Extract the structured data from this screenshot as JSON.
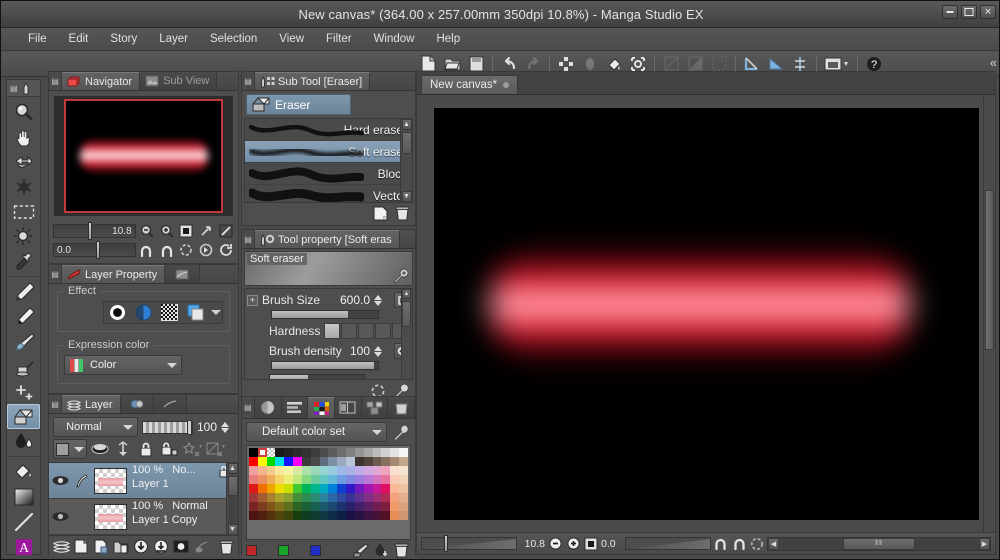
{
  "window": {
    "title": "New canvas* (364.00 x 257.00mm 350dpi 10.8%)  - Manga Studio EX",
    "minimize_label": "Minimize",
    "maximize_label": "Maximize",
    "close_label": "Close"
  },
  "menubar": {
    "items": [
      {
        "label": "File"
      },
      {
        "label": "Edit"
      },
      {
        "label": "Story"
      },
      {
        "label": "Layer"
      },
      {
        "label": "Selection"
      },
      {
        "label": "View"
      },
      {
        "label": "Filter"
      },
      {
        "label": "Window"
      },
      {
        "label": "Help"
      }
    ]
  },
  "command_toolbar": {
    "collapse_glyph": "«",
    "buttons": [
      {
        "name": "new-file-icon",
        "enabled": true
      },
      {
        "name": "open-file-icon",
        "enabled": true
      },
      {
        "name": "save-file-icon",
        "enabled": true
      },
      {
        "name": "undo-icon",
        "enabled": true
      },
      {
        "name": "redo-icon",
        "enabled": false
      },
      {
        "name": "select-all-icon",
        "enabled": true
      },
      {
        "name": "deselect-icon",
        "enabled": false
      },
      {
        "name": "fill-icon",
        "enabled": true
      },
      {
        "name": "transform-icon",
        "enabled": true
      },
      {
        "name": "clear-icon",
        "enabled": false
      },
      {
        "name": "invert-icon",
        "enabled": false
      },
      {
        "name": "selection-border-icon",
        "enabled": false
      },
      {
        "name": "ruler-line-icon",
        "enabled": true
      },
      {
        "name": "ruler-curve-icon",
        "enabled": true
      },
      {
        "name": "ruler-symmetry-icon",
        "enabled": true
      },
      {
        "name": "show-frame-icon",
        "enabled": true
      },
      {
        "name": "help-icon",
        "enabled": true
      }
    ]
  },
  "tools": {
    "groups": [
      {
        "items": [
          {
            "name": "zoom-tool",
            "label": "Zoom",
            "selected": false
          },
          {
            "name": "hand-tool",
            "label": "Hand",
            "selected": false
          },
          {
            "name": "move-tool",
            "label": "Move layer",
            "selected": false
          },
          {
            "name": "operation-tool",
            "label": "Operation",
            "selected": false
          },
          {
            "name": "rectangle-select-tool",
            "label": "Selection area",
            "selected": false
          },
          {
            "name": "auto-select-tool",
            "label": "Auto select",
            "selected": false
          },
          {
            "name": "eyedropper-tool",
            "label": "Eyedropper",
            "selected": false
          }
        ]
      },
      {
        "items": [
          {
            "name": "pencil-tool",
            "label": "Pencil",
            "selected": false
          },
          {
            "name": "pen-tool",
            "label": "Pen",
            "selected": false
          },
          {
            "name": "brush-tool",
            "label": "Brush",
            "selected": false
          },
          {
            "name": "airbrush-tool",
            "label": "Airbrush",
            "selected": false
          },
          {
            "name": "decoration-tool",
            "label": "Decoration",
            "selected": false
          },
          {
            "name": "eraser-tool",
            "label": "Eraser",
            "selected": true
          },
          {
            "name": "blend-tool",
            "label": "Blend",
            "selected": false
          }
        ]
      },
      {
        "items": [
          {
            "name": "fill-tool",
            "label": "Fill",
            "selected": false
          },
          {
            "name": "gradient-tool",
            "label": "Gradient",
            "selected": false
          },
          {
            "name": "figure-tool",
            "label": "Figure",
            "selected": false
          },
          {
            "name": "text-tool",
            "label": "Text",
            "selected": false
          }
        ]
      }
    ]
  },
  "navigator": {
    "tabs": [
      {
        "label": "Navigator",
        "icon": "navigator-icon",
        "active": true
      },
      {
        "label": "Sub View",
        "icon": "subview-icon",
        "active": false
      }
    ],
    "zoom_value": "10.8",
    "rotation_value": "0.0",
    "buttons": [
      {
        "name": "zoom-out-button"
      },
      {
        "name": "zoom-in-button"
      },
      {
        "name": "fit-to-screen-button"
      },
      {
        "name": "flip-horizontal-button"
      },
      {
        "name": "fit-diagonal-button"
      },
      {
        "name": "rotate-left-button"
      },
      {
        "name": "rotate-right-button"
      },
      {
        "name": "reset-rotation-button"
      },
      {
        "name": "flip-page-button"
      },
      {
        "name": "rotate-reset-button"
      }
    ]
  },
  "layer_property": {
    "tabs": [
      {
        "label": "Layer Property",
        "icon": "layer-property-icon",
        "active": true
      },
      {
        "label": "",
        "icon": "animation-icon",
        "active": false
      }
    ],
    "effect_group_label": "Effect",
    "effects": [
      {
        "name": "effect-border-icon",
        "selected": false
      },
      {
        "name": "effect-tone-icon",
        "selected": false
      },
      {
        "name": "effect-screen-icon",
        "selected": false
      },
      {
        "name": "effect-layer-color-icon",
        "selected": false
      }
    ],
    "expression_color_label": "Expression color",
    "expression_color_value": "Color"
  },
  "layer_panel": {
    "tabs": [
      {
        "label": "Layer",
        "icon": "layer-icon",
        "active": true
      },
      {
        "label": "",
        "icon": "animation-cels-icon",
        "active": false
      },
      {
        "label": "",
        "icon": "timeline-icon",
        "active": false
      }
    ],
    "blend_mode": "Normal",
    "opacity": "100",
    "toolbar_buttons": [
      {
        "name": "palette-color-button"
      },
      {
        "name": "mask-button"
      },
      {
        "name": "ruler-button"
      },
      {
        "name": "lock-layer-button"
      },
      {
        "name": "lock-transparent-pixels-button"
      },
      {
        "name": "set-as-reference-button"
      },
      {
        "name": "clipping-button"
      }
    ],
    "layers": [
      {
        "opacity": "100 %",
        "blend": "No...",
        "name": "Layer 1",
        "selected": true,
        "locked": true,
        "visible": true
      },
      {
        "opacity": "100 %",
        "blend": "Normal",
        "name": "Layer 1 Copy",
        "selected": false,
        "locked": false,
        "visible": true
      }
    ],
    "footer_buttons": [
      {
        "name": "layer-list-button"
      },
      {
        "name": "new-raster-layer-button"
      },
      {
        "name": "new-layer-from-selection-button"
      },
      {
        "name": "new-layer-folder-button"
      },
      {
        "name": "transfer-down-button"
      },
      {
        "name": "combine-down-button"
      },
      {
        "name": "layer-mask-button"
      },
      {
        "name": "apply-mask-button"
      },
      {
        "name": "delete-layer-button"
      }
    ]
  },
  "sub_tool": {
    "tabs": [
      {
        "label": "Sub Tool [Eraser]",
        "icon": "subtool-icon",
        "active": true
      }
    ],
    "group_label": "Eraser",
    "items": [
      {
        "label": "Hard eraser",
        "selected": false
      },
      {
        "label": "Soft eraser",
        "selected": true
      },
      {
        "label": "Block",
        "selected": false
      },
      {
        "label": "Vector",
        "selected": false
      }
    ],
    "footer_buttons": [
      {
        "name": "create-sub-tool-button"
      },
      {
        "name": "delete-sub-tool-button"
      }
    ]
  },
  "tool_property": {
    "tabs": [
      {
        "label": "Tool property [Soft eras",
        "icon": "tool-property-icon",
        "active": true
      }
    ],
    "preset_name": "Soft eraser",
    "rows": [
      {
        "label": "Brush Size",
        "value": "600.0",
        "type": "slider"
      },
      {
        "label": "Hardness",
        "value": "",
        "type": "steps"
      },
      {
        "label": "Brush density",
        "value": "100",
        "type": "slider"
      }
    ],
    "footer_buttons": [
      {
        "name": "reset-settings-button"
      },
      {
        "name": "sub-tool-detail-button"
      }
    ]
  },
  "color_panel": {
    "tabs": [
      {
        "name": "color-wheel-tab",
        "active": false
      },
      {
        "name": "color-slider-tab",
        "active": false
      },
      {
        "name": "color-set-tab",
        "active": true
      },
      {
        "name": "intermediate-color-tab",
        "active": false
      },
      {
        "name": "approximate-color-tab",
        "active": false
      },
      {
        "name": "material-tab",
        "active": false
      }
    ],
    "color_set_name": "Default color set",
    "settings_button": "color-set-settings-button",
    "footer_swatches": [
      {
        "name": "main-color-swatch",
        "color": "#c0262a"
      },
      {
        "name": "sub-color-swatch",
        "color": "#18a52a"
      },
      {
        "name": "transparent-color-swatch",
        "color": "#1f2ec4"
      }
    ],
    "footer_buttons": [
      {
        "name": "add-color-button"
      },
      {
        "name": "replace-color-button"
      },
      {
        "name": "delete-color-button"
      }
    ],
    "grid": [
      [
        "#000000",
        "#ffffff",
        "#cccccc",
        "#1a1a1a",
        "#222222",
        "#2b2b2b",
        "#333333",
        "#3d3d3d",
        "#4c4c4c",
        "#5c5c5c",
        "#6e6e6e",
        "#808080",
        "#949494",
        "#a8a8a8",
        "#bcbcbc",
        "#d0d0d0",
        "#e4e4e4",
        "#f5f5f5"
      ],
      [
        "#ff0000",
        "#ffff00",
        "#00d800",
        "#00e0e0",
        "#1414ff",
        "#ff00ff",
        "#3a3a3a",
        "#4a4a4a",
        "#5f6f80",
        "#7d8fa4",
        "#9aa9bd",
        "#bac6d6",
        "#3c3430",
        "#4f433b",
        "#6b5a4e",
        "#86705f",
        "#a78872",
        "#c4a68c"
      ],
      [
        "#f0a0a0",
        "#f3b58f",
        "#f6cb8e",
        "#f9e79a",
        "#f6f4a0",
        "#d4ebA0",
        "#adE0a8",
        "#9ad8bb",
        "#96d5d0",
        "#96ccdf",
        "#9cb9e6",
        "#aab0e8",
        "#bcabe6",
        "#d0a9e0",
        "#e2a6d3",
        "#f0a3bc",
        "#fadfd0",
        "#f7e3d2"
      ],
      [
        "#e87c7c",
        "#ea9162",
        "#eeae5c",
        "#f2d46b",
        "#eaee78",
        "#bfe87a",
        "#86d882",
        "#6ccb9e",
        "#66c7c2",
        "#66b8d8",
        "#6f9ce0",
        "#8188e2",
        "#9d7ee0",
        "#b878d4",
        "#d276c0",
        "#e673a0",
        "#f9cbb4",
        "#f4d3bb"
      ],
      [
        "#e01818",
        "#f07000",
        "#f0a400",
        "#f0dc00",
        "#c8e000",
        "#44c832",
        "#00b45a",
        "#00b48c",
        "#00a8c0",
        "#0080d8",
        "#1040d0",
        "#3018c8",
        "#7018c0",
        "#a018b0",
        "#c8189a",
        "#e01060",
        "#fbb897",
        "#efc2a3"
      ],
      [
        "#a03838",
        "#a45c32",
        "#a8802e",
        "#a8a22e",
        "#8aa030",
        "#45903a",
        "#2c8c52",
        "#2a8c76",
        "#2a849c",
        "#2a68a4",
        "#2c4aa0",
        "#3c3296",
        "#60308e",
        "#823086",
        "#9c2e74",
        "#ac2c54",
        "#f5a27c",
        "#e3b08f"
      ],
      [
        "#7a2424",
        "#7d3e20",
        "#80561c",
        "#80701c",
        "#5e7020",
        "#2c6424",
        "#1c6038",
        "#1a6052",
        "#1a5a6c",
        "#1a4870",
        "#1c3370",
        "#2a2268",
        "#42206a",
        "#5c2062",
        "#6e1e52",
        "#7c1e3c",
        "#f09a6b",
        "#d9a37e"
      ],
      [
        "#4e1414",
        "#501f10",
        "#52310c",
        "#52460c",
        "#3c460e",
        "#183e10",
        "#0e3c22",
        "#0e3c32",
        "#0e3844",
        "#0e2c48",
        "#0e1f48",
        "#1a1244",
        "#2b1244",
        "#3c1240",
        "#481034",
        "#521026",
        "#e88d56",
        "#cf9a73"
      ]
    ]
  },
  "canvas": {
    "tab_label": "New canvas*",
    "close_dot": "●",
    "statusbar": {
      "zoom_value": "10.8",
      "rotation_value": "0.0",
      "buttons": [
        {
          "name": "zoom-out-button"
        },
        {
          "name": "zoom-in-button"
        },
        {
          "name": "fit-to-window-button"
        },
        {
          "name": "rotate-left-button"
        },
        {
          "name": "rotate-right-button"
        },
        {
          "name": "reset-rotation-button"
        }
      ],
      "scroll_grip": "‖‖"
    }
  }
}
